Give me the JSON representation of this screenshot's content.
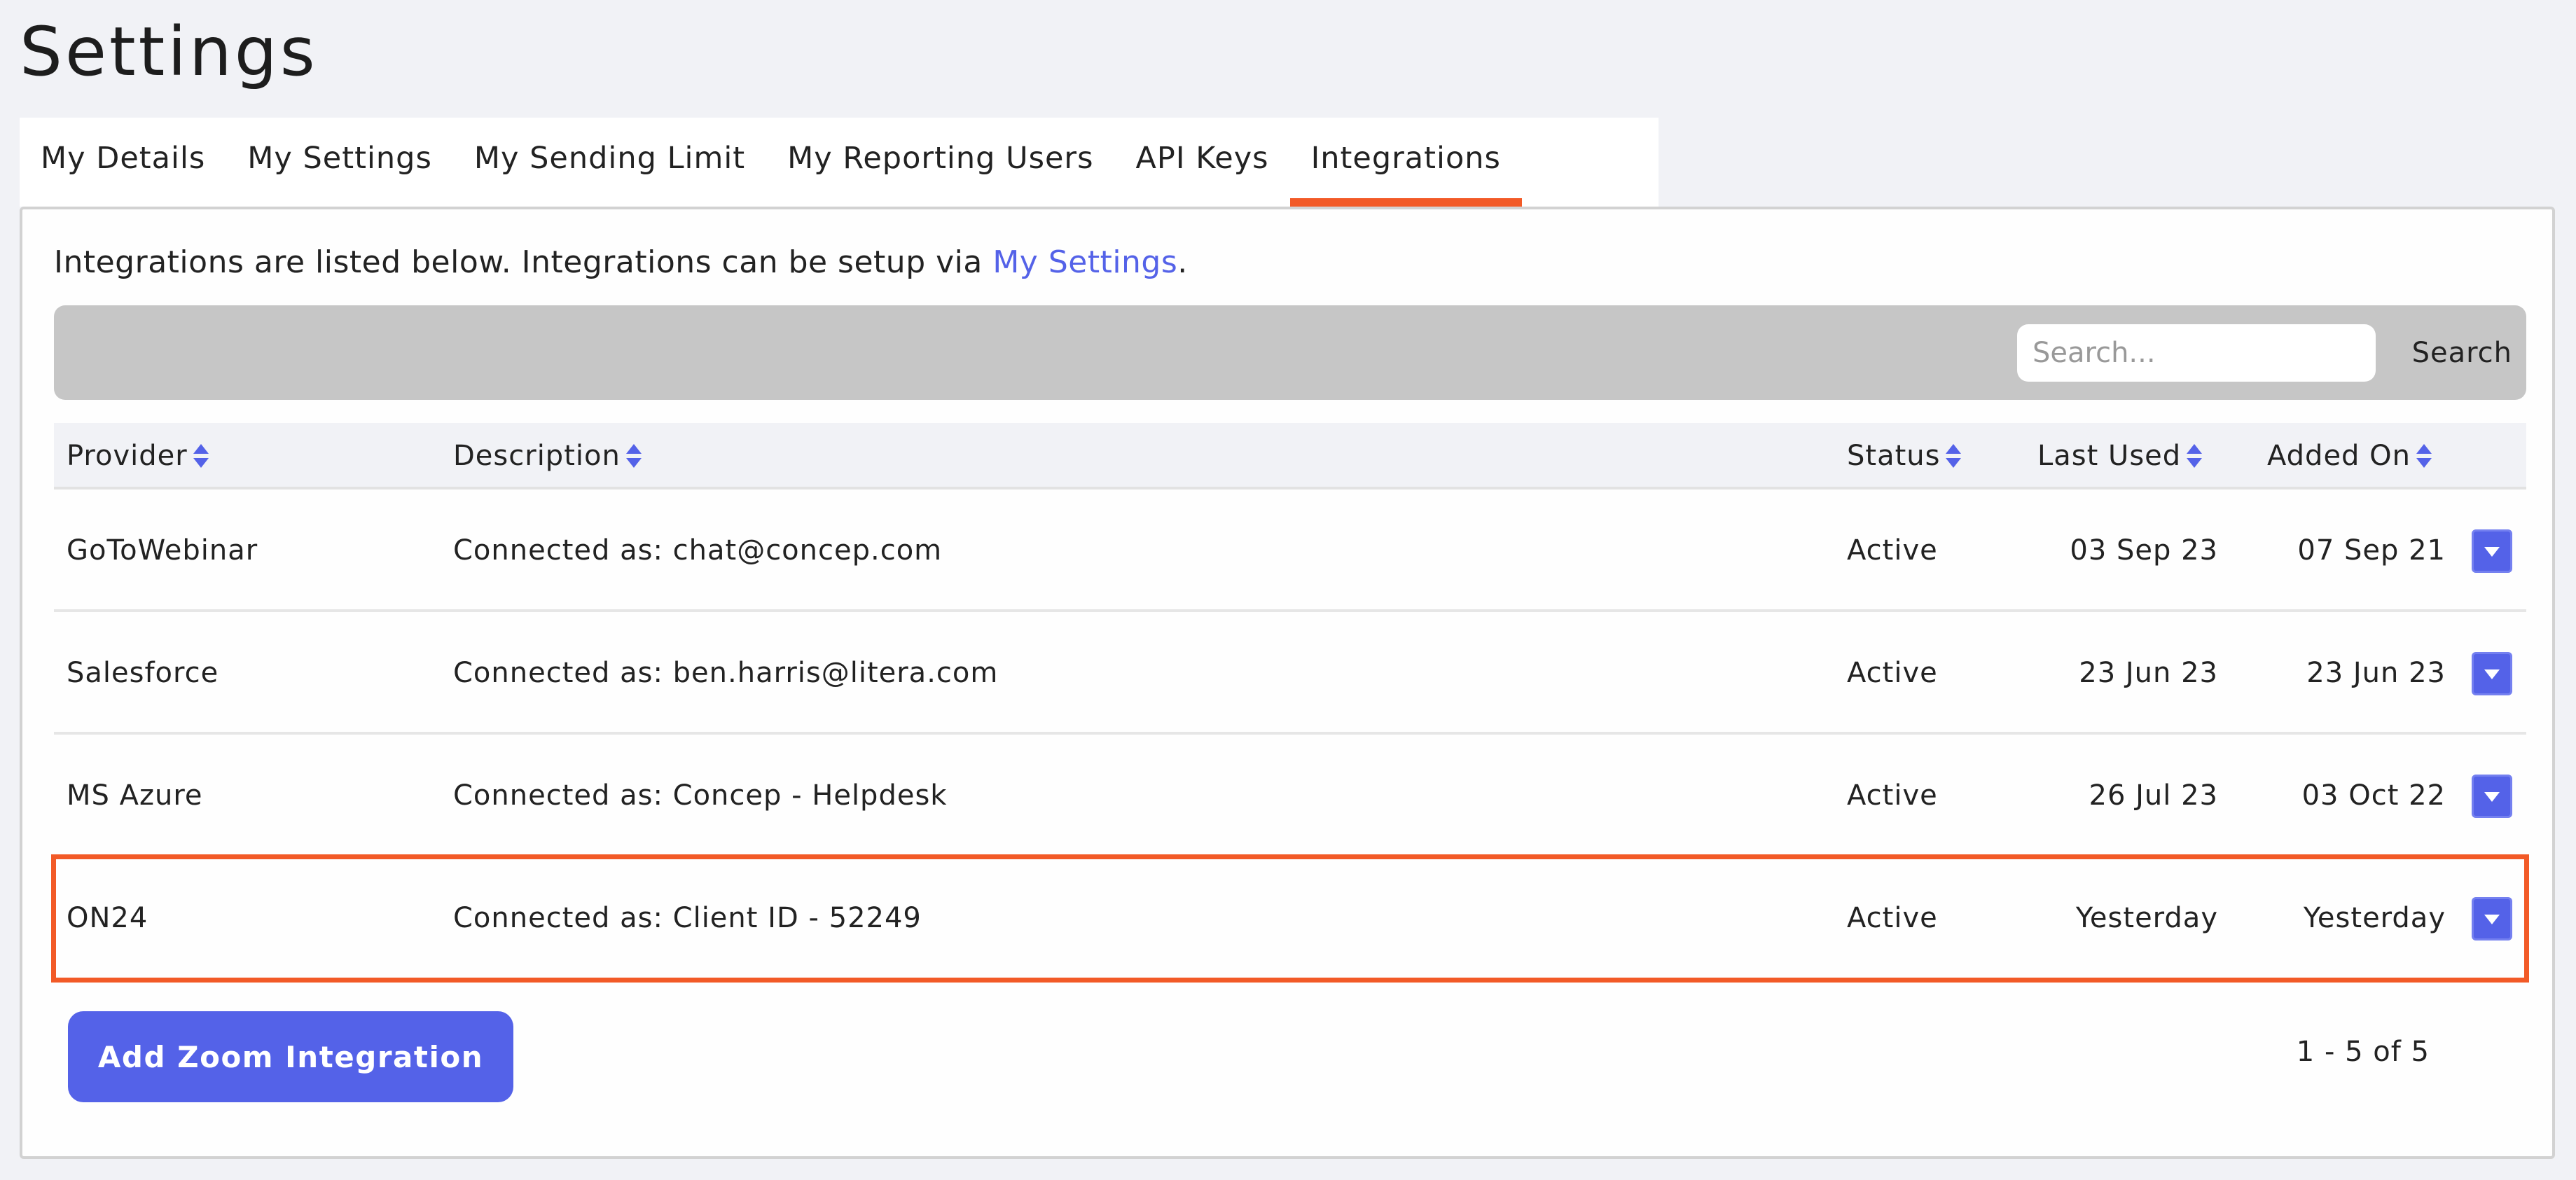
{
  "page": {
    "title": "Settings"
  },
  "tabs": [
    {
      "label": "My Details",
      "active": false
    },
    {
      "label": "My Settings",
      "active": false
    },
    {
      "label": "My Sending Limit",
      "active": false
    },
    {
      "label": "My Reporting Users",
      "active": false
    },
    {
      "label": "API Keys",
      "active": false
    },
    {
      "label": "Integrations",
      "active": true
    }
  ],
  "intro": {
    "text": "Integrations are listed below. Integrations can be setup via ",
    "link": "My Settings",
    "suffix": "."
  },
  "search": {
    "placeholder": "Search...",
    "value": "",
    "button_label": "Search"
  },
  "table": {
    "columns": [
      "Provider",
      "Description",
      "Status",
      "Last Used",
      "Added On"
    ],
    "rows": [
      {
        "provider": "GoToWebinar",
        "description": "Connected as: chat@concep.com",
        "status": "Active",
        "last_used": "03 Sep 23",
        "added_on": "07 Sep 21",
        "highlighted": false
      },
      {
        "provider": "Salesforce",
        "description": "Connected as: ben.harris@litera.com",
        "status": "Active",
        "last_used": "23 Jun 23",
        "added_on": "23 Jun 23",
        "highlighted": false
      },
      {
        "provider": "MS Azure",
        "description": "Connected as: Concep - Helpdesk",
        "status": "Active",
        "last_used": "26 Jul 23",
        "added_on": "03 Oct 22",
        "highlighted": false
      },
      {
        "provider": "ON24",
        "description": "Connected as: Client ID - 52249",
        "status": "Active",
        "last_used": "Yesterday",
        "added_on": "Yesterday",
        "highlighted": true
      }
    ]
  },
  "footer": {
    "add_button_label": "Add Zoom Integration",
    "pagination": "1 - 5 of 5"
  },
  "colors": {
    "accent": "#5462e8",
    "highlight": "#f25a27",
    "search_bar": "#c6c6c6",
    "background": "#f1f2f6"
  }
}
